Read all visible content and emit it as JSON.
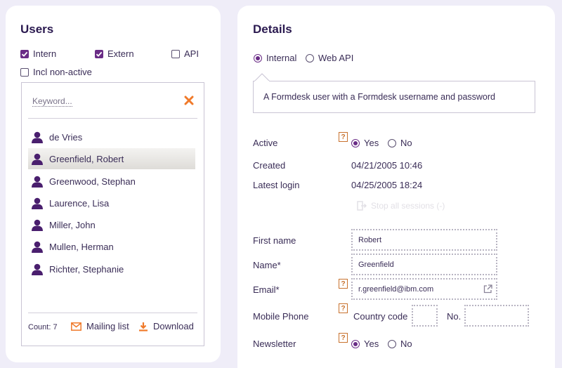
{
  "users_panel": {
    "title": "Users",
    "filters": {
      "intern": {
        "label": "Intern",
        "checked": true
      },
      "extern": {
        "label": "Extern",
        "checked": true
      },
      "api": {
        "label": "API",
        "checked": false
      },
      "incl_non_active": {
        "label": "Incl non-active",
        "checked": false
      }
    },
    "search": {
      "placeholder": "Keyword..."
    },
    "users": [
      {
        "name": "de Vries",
        "selected": false
      },
      {
        "name": "Greenfield, Robert",
        "selected": true
      },
      {
        "name": "Greenwood, Stephan",
        "selected": false
      },
      {
        "name": "Laurence, Lisa",
        "selected": false
      },
      {
        "name": "Miller, John",
        "selected": false
      },
      {
        "name": "Mullen, Herman",
        "selected": false
      },
      {
        "name": "Richter, Stephanie",
        "selected": false
      }
    ],
    "footer": {
      "count_label": "Count: 7",
      "mailing_list_label": "Mailing list",
      "download_label": "Download"
    }
  },
  "details_panel": {
    "title": "Details",
    "user_type": {
      "options": [
        "Internal",
        "Web API"
      ],
      "selected": "Internal"
    },
    "description": "A Formdesk user with a Formdesk username and password",
    "help_glyph": "?",
    "active": {
      "label": "Active",
      "yes_label": "Yes",
      "no_label": "No",
      "value": "Yes"
    },
    "created": {
      "label": "Created",
      "value": "04/21/2005 10:46"
    },
    "latest_login": {
      "label": "Latest login",
      "value": "04/25/2005 18:24"
    },
    "stop_sessions_label": "Stop all sessions (-)",
    "first_name": {
      "label": "First name",
      "value": "Robert"
    },
    "name": {
      "label": "Name*",
      "value": "Greenfield"
    },
    "email": {
      "label": "Email*",
      "value": "r.greenfield@ibm.com"
    },
    "mobile_phone": {
      "label": "Mobile Phone",
      "country_code_label": "Country code",
      "country_code_value": "",
      "number_label": "No.",
      "number_value": ""
    },
    "newsletter": {
      "label": "Newsletter",
      "yes_label": "Yes",
      "no_label": "No",
      "value": "Yes"
    }
  },
  "colors": {
    "accent": "#6a2c86",
    "orange": "#f07a2a",
    "background": "#efedf8",
    "title": "#2b1a50"
  }
}
